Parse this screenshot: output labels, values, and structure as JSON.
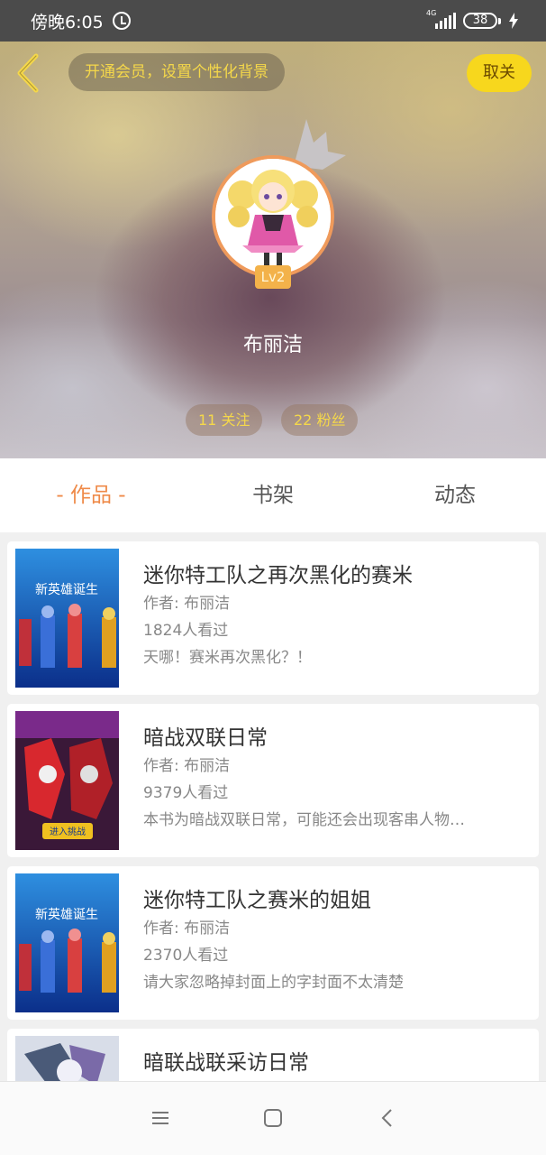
{
  "status_bar": {
    "time": "傍晚6:05",
    "network": "4G",
    "battery": "38"
  },
  "header": {
    "vip_prompt": "开通会员，设置个性化背景",
    "unfollow_label": "取关"
  },
  "profile": {
    "level": "Lv2",
    "name": "布丽洁",
    "following": "11 关注",
    "followers": "22 粉丝"
  },
  "tabs": [
    {
      "label": "- 作品 -",
      "active": true
    },
    {
      "label": "书架",
      "active": false
    },
    {
      "label": "动态",
      "active": false
    }
  ],
  "works": [
    {
      "title": "迷你特工队之再次黑化的赛米",
      "author": "作者: 布丽洁",
      "views": "1824人看过",
      "desc": "天哪！赛米再次黑化？！",
      "cover_text": "新英雄诞生"
    },
    {
      "title": "暗战双联日常",
      "author": "作者: 布丽洁",
      "views": "9379人看过",
      "desc": "本书为暗战双联日常，可能还会出现客串人物…",
      "cover_text": "进入挑战"
    },
    {
      "title": "迷你特工队之赛米的姐姐",
      "author": "作者: 布丽洁",
      "views": "2370人看过",
      "desc": "请大家忽略掉封面上的字封面不太清楚",
      "cover_text": "新英雄诞生"
    },
    {
      "title": "暗联战联采访日常",
      "author": "",
      "views": "",
      "desc": "",
      "cover_text": ""
    }
  ],
  "colors": {
    "accent": "#ef8a48",
    "gold": "#f5d84a",
    "unfollow_bg": "#f7d71d"
  },
  "icons": {
    "back": "chevron-left-icon",
    "crown": "crown-icon",
    "menu": "menu-icon",
    "home": "home-icon",
    "nav_back": "nav-back-icon"
  }
}
